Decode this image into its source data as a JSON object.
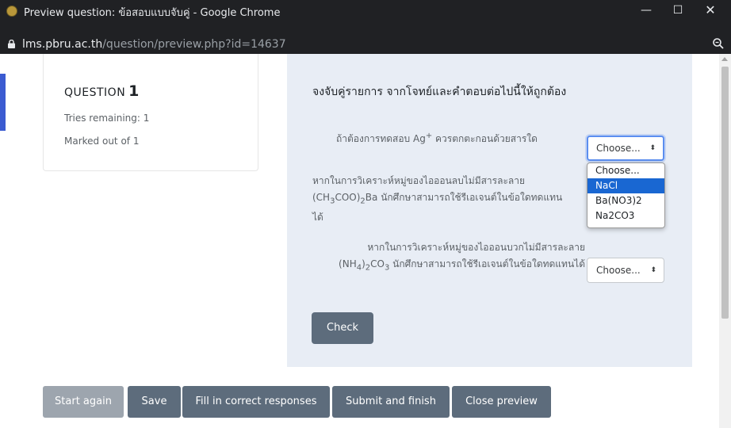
{
  "browser": {
    "window_title": "Preview question: ข้อสอบแบบจับคู่ - Google Chrome",
    "url_host": "lms.pbru.ac.th",
    "url_path": "/question/preview.php?id=14637",
    "controls": {
      "minimize": "—",
      "maximize": "☐",
      "close": "✕"
    }
  },
  "question_info": {
    "heading": "QUESTION",
    "number": "1",
    "tries": "Tries remaining: 1",
    "marked": "Marked out of 1"
  },
  "question": {
    "prompt": "จงจับคู่รายการ จากโจทย์และคำตอบต่อไปนี้ให้ถูกต้อง",
    "stem1": {
      "text": "ถ้าต้องการทดสอบ Ag",
      "sup": "+",
      "text_after": " ควรตกตะกอนด้วยสารใด"
    },
    "stem2": {
      "line1": "หากในการวิเคราะห์หมู่ของไอออนลบไม่มีสารละลาย",
      "p1": "(CH",
      "sub1": "3",
      "p2": "COO)",
      "sub2": "2",
      "p3": "Ba นักศึกษาสามารถใช้รีเอเจนต์ในข้อใดทดแทน",
      "line3": "ได้"
    },
    "stem3": {
      "line1": "หากในการวิเคราะห์หมู่ของไอออนบวกไม่มีสารละลาย",
      "p1": "(NH",
      "sub1": "4",
      "p2": ")",
      "sub2": "2",
      "p3": "CO",
      "sub3": "3",
      "p4": " นักศึกษาสามารถใช้รีเอเจนต์ในข้อใดทดแทนได้"
    },
    "select_value": "Choose...",
    "select_arrow": "⬍",
    "options": [
      "Choose...",
      "NaCl",
      "Ba(NO3)2",
      "Na2CO3"
    ],
    "highlighted_option": "NaCl",
    "check_label": "Check"
  },
  "actions": {
    "start_again": "Start again",
    "save": "Save",
    "fill_correct": "Fill in correct responses",
    "submit_finish": "Submit and finish",
    "close_preview": "Close preview"
  },
  "icons": {
    "favicon": "university-seal-icon",
    "lock": "lock-icon",
    "zoom": "zoom-icon"
  },
  "colors": {
    "accent_blue": "#3b5bd1",
    "content_bg": "#e8edf5",
    "button_bg": "#5d6c7c",
    "button_disabled_bg": "#9da5ae",
    "option_highlight": "#1967d2"
  }
}
